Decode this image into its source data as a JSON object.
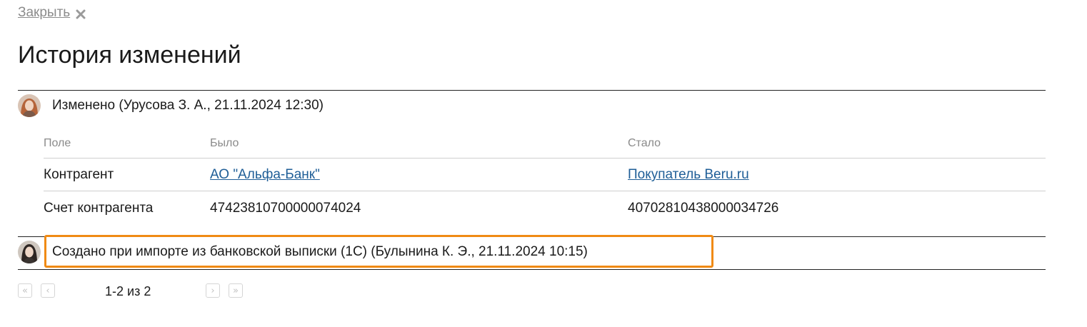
{
  "header": {
    "close_label": "Закрыть",
    "close_icon": "close-icon",
    "title": "История изменений"
  },
  "history": {
    "entries": [
      {
        "avatar": "user-avatar-female-red-hair",
        "text": "Изменено (Урусова З. А., 21.11.2024 12:30)",
        "table": {
          "columns": [
            "Поле",
            "Было",
            "Стало"
          ],
          "rows": [
            {
              "field": "Контрагент",
              "old": "АО \"Альфа-Банк\"",
              "new": "Покупатель Beru.ru"
            },
            {
              "field": "Счет контрагента",
              "old": "47423810700000074024",
              "new": "40702810438000034726"
            }
          ]
        }
      },
      {
        "avatar": "user-avatar-female-dark-hair",
        "text": "Создано при импорте из банковской выписки (1С) (Булынина К. Э., 21.11.2024 10:15)"
      }
    ]
  },
  "pagination": {
    "text": "1-2 из 2",
    "first_icon": "«",
    "prev_icon": "‹",
    "next_icon": "›",
    "last_icon": "»"
  },
  "colors": {
    "link": "#1f5e97",
    "highlight": "#f08a14",
    "muted": "#8a8a8a"
  }
}
